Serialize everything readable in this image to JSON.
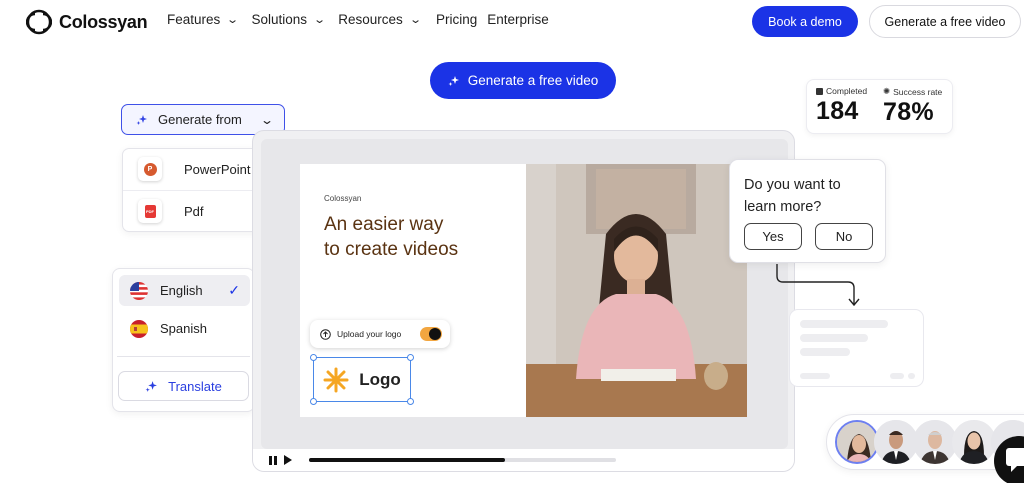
{
  "header": {
    "brand": "Colossyan",
    "nav": [
      {
        "label": "Features",
        "has_menu": true
      },
      {
        "label": "Solutions",
        "has_menu": true
      },
      {
        "label": "Resources",
        "has_menu": true
      },
      {
        "label": "Pricing",
        "has_menu": false
      },
      {
        "label": "Enterprise",
        "has_menu": false
      }
    ],
    "book_demo": "Book a demo",
    "generate_free_video": "Generate a free video"
  },
  "hero": {
    "cta": "Generate a free video"
  },
  "stats": {
    "completed_label": "Completed",
    "completed_value": "184",
    "success_label": "Success rate",
    "success_value": "78%"
  },
  "generate_from": {
    "label": "Generate from",
    "sources": [
      "PowerPoint",
      "Pdf"
    ],
    "source_badges": [
      "P",
      "PDF"
    ]
  },
  "languages": {
    "items": [
      {
        "label": "English",
        "selected": true
      },
      {
        "label": "Spanish",
        "selected": false
      }
    ],
    "translate": "Translate"
  },
  "slide": {
    "brand": "Colossyan",
    "title_line1": "An easier way",
    "title_line2": "to create videos",
    "upload_label": "Upload your logo",
    "logo_text": "Logo"
  },
  "player": {
    "progress": 0.64
  },
  "question": {
    "line1": "Do you want to",
    "line2": "learn more?",
    "yes": "Yes",
    "no": "No"
  },
  "colors": {
    "brand_blue": "#1b33e6",
    "slide_title": "#5a3312",
    "toggle": "#f2a640"
  }
}
